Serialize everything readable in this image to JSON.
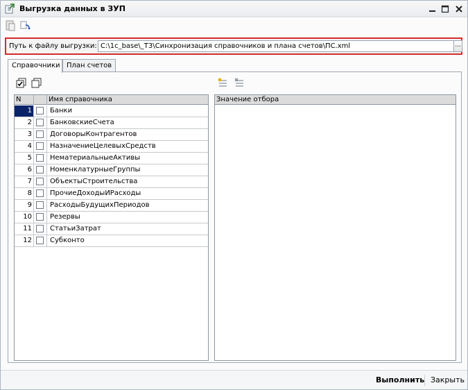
{
  "window": {
    "title": "Выгрузка данных в ЗУП",
    "controls": [
      "minimize-icon",
      "maximize-icon",
      "close-icon"
    ]
  },
  "toolbar": {
    "icons": [
      "document-icon",
      "refresh-arrow-icon"
    ]
  },
  "path": {
    "label": "Путь к файлу выгрузки:",
    "value": "C:\\1c_base\\_T3\\Синхронизация справочников и плана счетов\\ПС.xml",
    "browse": "..."
  },
  "tabs": [
    {
      "label": "Справочники",
      "active": true
    },
    {
      "label": "План счетов",
      "active": false
    }
  ],
  "left_panel": {
    "tools": [
      "check-all-icon",
      "uncheck-all-icon"
    ],
    "columns": {
      "n": "N",
      "check": "",
      "name": "Имя справочника"
    },
    "rows": [
      {
        "n": "1",
        "name": "Банки",
        "checked": false,
        "selected": true
      },
      {
        "n": "2",
        "name": "БанковскиеСчета",
        "checked": false
      },
      {
        "n": "3",
        "name": "ДоговорыКонтрагентов",
        "checked": false
      },
      {
        "n": "4",
        "name": "НазначениеЦелевыхСредств",
        "checked": false
      },
      {
        "n": "5",
        "name": "НематериальныеАктивы",
        "checked": false
      },
      {
        "n": "6",
        "name": "НоменклатурныеГруппы",
        "checked": false
      },
      {
        "n": "7",
        "name": "ОбъектыСтроительства",
        "checked": false
      },
      {
        "n": "8",
        "name": "ПрочиеДоходыИРасходы",
        "checked": false
      },
      {
        "n": "9",
        "name": "РасходыБудущихПериодов",
        "checked": false
      },
      {
        "n": "10",
        "name": "Резервы",
        "checked": false
      },
      {
        "n": "11",
        "name": "СтатьиЗатрат",
        "checked": false
      },
      {
        "n": "12",
        "name": "Субконто",
        "checked": false
      }
    ]
  },
  "right_panel": {
    "tools": [
      "add-filter-icon",
      "remove-filter-icon"
    ],
    "column": "Значение отбора"
  },
  "footer": {
    "run_label": "Выполнить",
    "close_label": "Закрыть"
  }
}
